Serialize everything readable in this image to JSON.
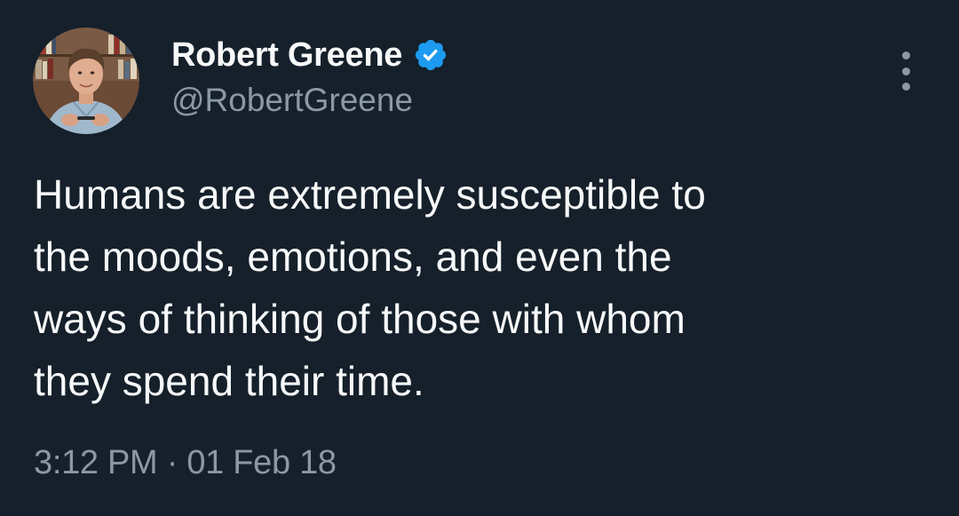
{
  "author": {
    "display_name": "Robert Greene",
    "handle": "@RobertGreene",
    "verified": true,
    "verified_color": "#1d9bf0",
    "avatar_icon": "profile-photo"
  },
  "tweet": {
    "text_lines": [
      "Humans are extremely susceptible to",
      "the moods, emotions, and even the",
      "ways of thinking of those with whom",
      "they spend their time."
    ],
    "time": "3:12 PM",
    "separator": "·",
    "date": "01 Feb 18"
  },
  "actions": {
    "more_icon": "more-vertical-icon"
  },
  "colors": {
    "background": "#15202b",
    "primary_text": "#f7f9f9",
    "secondary_text": "#8b98a5"
  }
}
